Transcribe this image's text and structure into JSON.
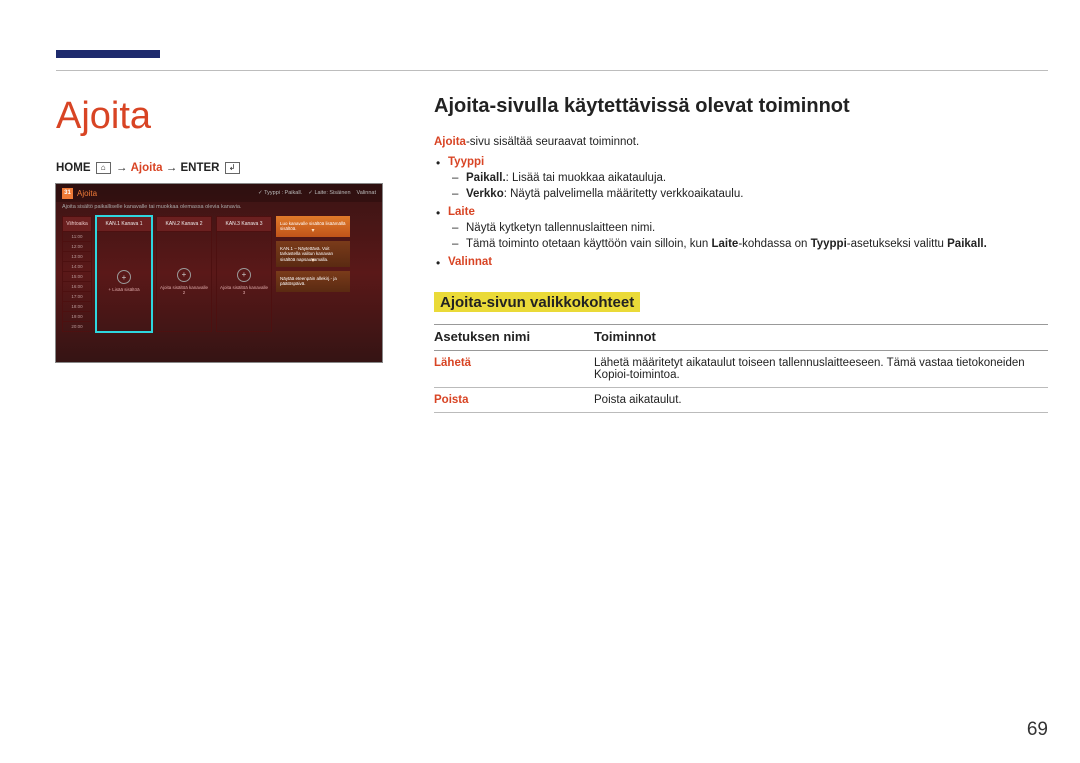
{
  "page_number": "69",
  "left": {
    "title": "Ajoita",
    "path_prefix": "HOME",
    "path_arrow": "→",
    "path_accent": "Ajoita",
    "path_enter": "ENTER",
    "mock": {
      "cal_num": "31",
      "app_name": "Ajoita",
      "top_right_type": "Tyyppi : Paikall.",
      "top_right_device": "Laite: Sisäinen",
      "top_right_options": "Valinnat",
      "subtitle": "Ajoita sisältö paikalliselle kanavalle tai muokkaa olemassa olevia kanavia.",
      "time_header": "Viihtoaika",
      "times": [
        "11:00",
        "12:00",
        "13:00",
        "14:00",
        "15:00",
        "16:00",
        "17:00",
        "18:00",
        "19:00",
        "20:00"
      ],
      "channels": [
        {
          "hdr": "KAN.1 Kanava 1",
          "caption": "+ Lisää sisältöä",
          "selected": true
        },
        {
          "hdr": "KAN.2 Kanava 2",
          "caption": "Ajoita sisältöä kanavalle 2",
          "selected": false
        },
        {
          "hdr": "KAN.3 Kanava 3",
          "caption": "Ajoita sisältöä kanavalle 3",
          "selected": false
        }
      ],
      "right_boxes": [
        "Luo kanavalle sisältöä lisäämällä sisältöä.",
        "KAN.1 – Näytettävä. Voit tarkastella valitun kanavan sisältöä napsauttamalla.",
        "Näytää eteenpäin allekirj.- ja päätöspäivä."
      ]
    }
  },
  "right": {
    "h2": "Ajoita-sivulla käytettävissä olevat toiminnot",
    "intro_accent": "Ajoita",
    "intro_rest": "-sivu sisältää seuraavat toiminnot.",
    "bullets": {
      "type": {
        "label": "Tyyppi",
        "sub1_label": "Paikall.",
        "sub1_text": ": Lisää tai muokkaa aikatauluja.",
        "sub2_label": "Verkko",
        "sub2_text": ": Näytä palvelimella määritetty verkkoaikataulu."
      },
      "device": {
        "label": "Laite",
        "sub1": "Näytä kytketyn tallennuslaitteen nimi.",
        "sub2_pre": "Tämä toiminto otetaan käyttöön vain silloin, kun ",
        "sub2_k1": "Laite",
        "sub2_mid1": "-kohdassa on ",
        "sub2_k2": "Tyyppi",
        "sub2_mid2": "-asetukseksi valittu ",
        "sub2_k3": "Paikall.",
        "sub2_end": ""
      },
      "options": {
        "label": "Valinnat"
      }
    },
    "h3": "Ajoita-sivun valikkokohteet",
    "table": {
      "th1": "Asetuksen nimi",
      "th2": "Toiminnot",
      "rows": [
        {
          "name": "Lähetä",
          "desc": "Lähetä määritetyt aikataulut toiseen tallennuslaitteeseen. Tämä vastaa tietokoneiden Kopioi-toimintoa."
        },
        {
          "name": "Poista",
          "desc": "Poista aikataulut."
        }
      ]
    }
  }
}
